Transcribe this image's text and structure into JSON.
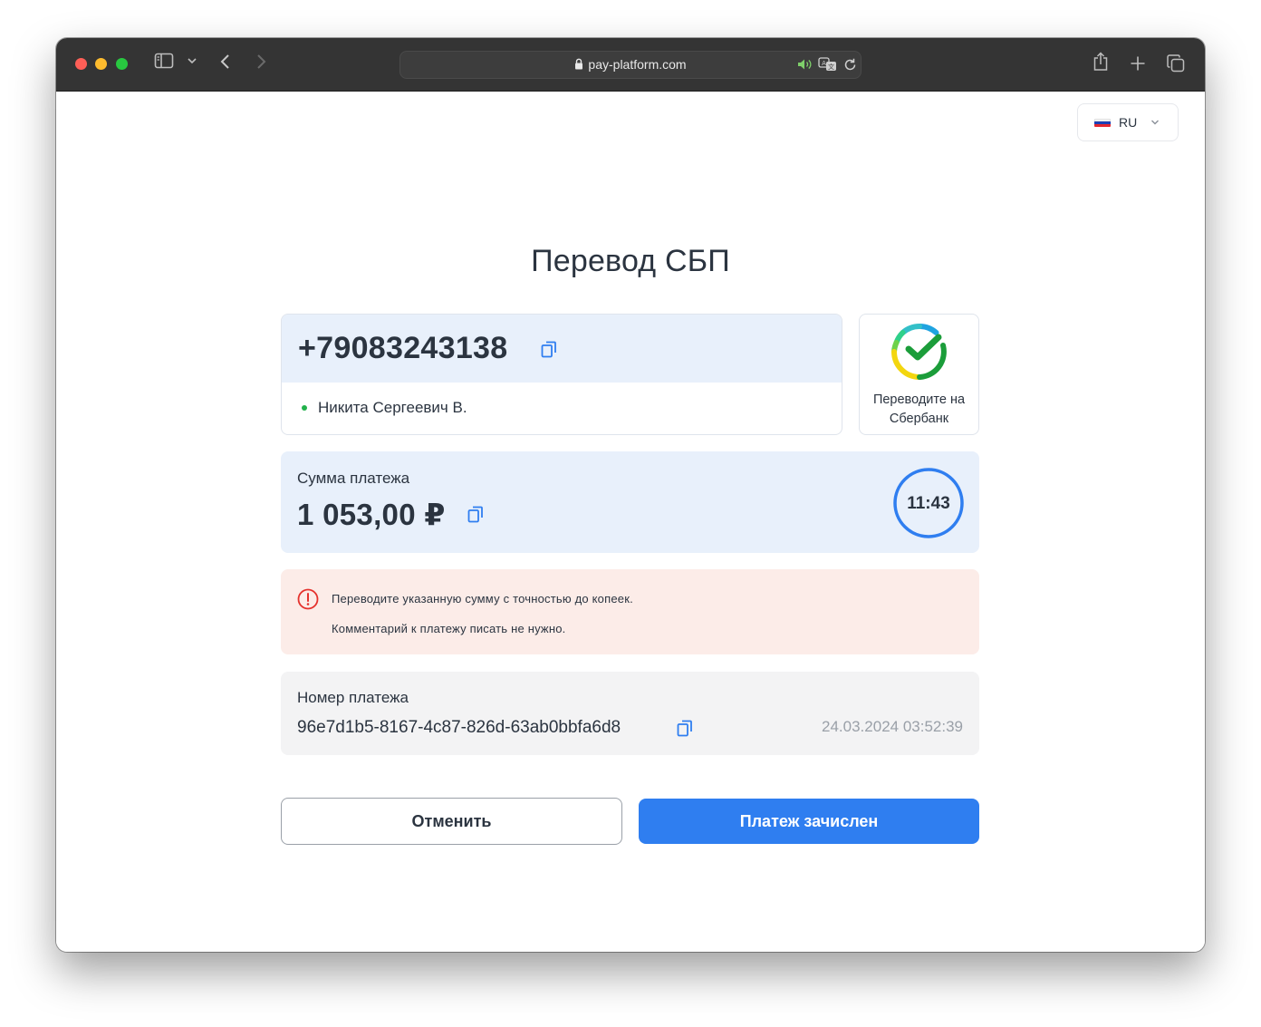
{
  "browser": {
    "url": "pay-platform.com",
    "icons": [
      "sidebar-icon",
      "chevron-down-icon",
      "back-icon",
      "forward-icon",
      "lock-icon",
      "speaker-icon",
      "translate-icon",
      "reload-icon",
      "share-icon",
      "new-tab-icon",
      "tabs-overview-icon"
    ]
  },
  "language": {
    "label": "RU",
    "flag": "russia-flag"
  },
  "page": {
    "title": "Перевод СБП"
  },
  "recipient": {
    "phone": "+79083243138",
    "name": "Никита Сергеевич В.",
    "bank_text_line1": "Переводите на",
    "bank_text_line2": "Сбербанк"
  },
  "payment": {
    "amount_label": "Сумма платежа",
    "amount_value": "1 053,00 ₽",
    "timer": "11:43"
  },
  "warning": {
    "line1": "Переводите указанную сумму с точностью до копеек.",
    "line2": "Комментарий к платежу писать не нужно."
  },
  "payment_id": {
    "label": "Номер платежа",
    "value": "96e7d1b5-8167-4c87-826d-63ab0bbfa6d8",
    "date": "24.03.2024 03:52:39"
  },
  "buttons": {
    "cancel": "Отменить",
    "confirm": "Платеж зачислен"
  },
  "colors": {
    "accent": "#2f7ef0",
    "warning_bg": "#fcece8",
    "warning_icon": "#e5322d",
    "info_bg": "#e8f0fb",
    "status_dot": "#22b14c"
  }
}
